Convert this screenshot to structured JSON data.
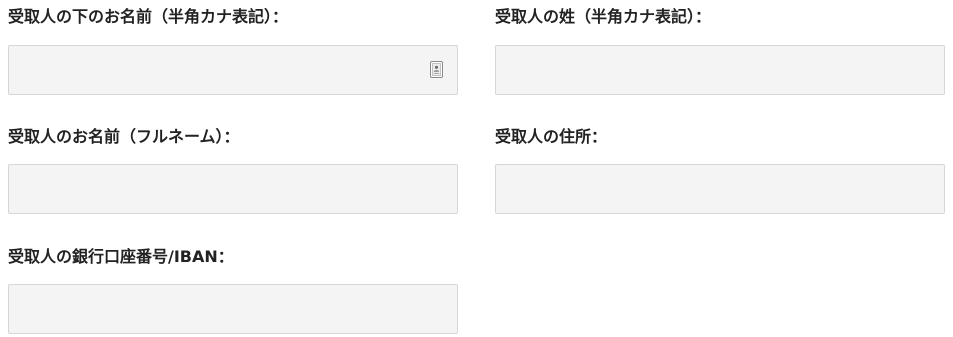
{
  "form": {
    "fields": [
      {
        "label": "受取人の下のお名前（半角カナ表記）：",
        "value": "",
        "placeholder": ""
      },
      {
        "label": "受取人の姓（半角カナ表記）：",
        "value": "",
        "placeholder": ""
      },
      {
        "label": "受取人のお名前（フルネーム）：",
        "value": "",
        "placeholder": ""
      },
      {
        "label": "受取人の住所：",
        "value": "",
        "placeholder": ""
      },
      {
        "label": "受取人の銀行口座番号/IBAN：",
        "value": "",
        "placeholder": ""
      }
    ],
    "autofill_icon": "contact-card-icon"
  }
}
